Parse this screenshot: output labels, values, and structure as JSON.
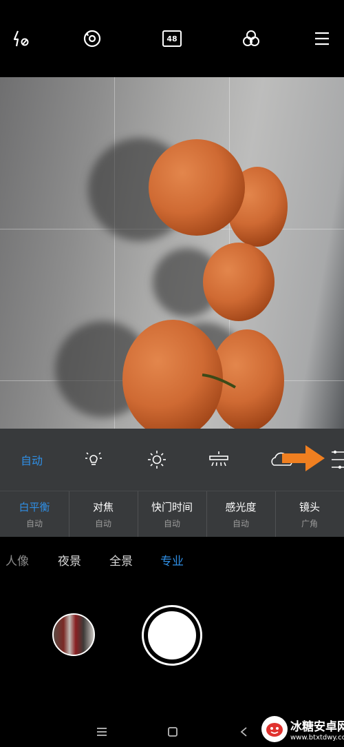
{
  "top_bar": {
    "flash": {
      "icon": "flash-off-icon"
    },
    "lens": {
      "icon": "lens-switch-icon"
    },
    "resolution": {
      "icon": "resolution-icon",
      "label": "48"
    },
    "filters": {
      "icon": "filters-icon"
    },
    "menu": {
      "icon": "menu-icon"
    }
  },
  "white_balance": {
    "selected": "自动",
    "options": [
      {
        "icon": "auto-wb",
        "label": "自动"
      },
      {
        "icon": "incandescent-icon"
      },
      {
        "icon": "daylight-icon"
      },
      {
        "icon": "fluorescent-icon"
      },
      {
        "icon": "cloudy-icon"
      }
    ],
    "adjust": {
      "icon": "adjust-sliders-icon"
    },
    "annotation": {
      "icon": "orange-arrow-icon",
      "color": "#f07f20"
    }
  },
  "params": [
    {
      "label": "白平衡",
      "value": "自动",
      "active": true
    },
    {
      "label": "对焦",
      "value": "自动"
    },
    {
      "label": "快门时间",
      "value": "自动"
    },
    {
      "label": "感光度",
      "value": "自动"
    },
    {
      "label": "镜头",
      "value": "广角"
    }
  ],
  "modes": {
    "items": [
      "人像",
      "夜景",
      "全景",
      "专业"
    ],
    "selected": "专业"
  },
  "colors": {
    "accent": "#2f8fe6",
    "panel_bg": "#3a3c3e",
    "arrow": "#f07f20"
  },
  "nav": {
    "menu_icon": "nav-menu-icon",
    "home_icon": "nav-home-icon",
    "back_icon": "nav-back-icon"
  },
  "watermark": {
    "name": "冰糖安卓网",
    "url": "www.btxtdwy.com"
  }
}
